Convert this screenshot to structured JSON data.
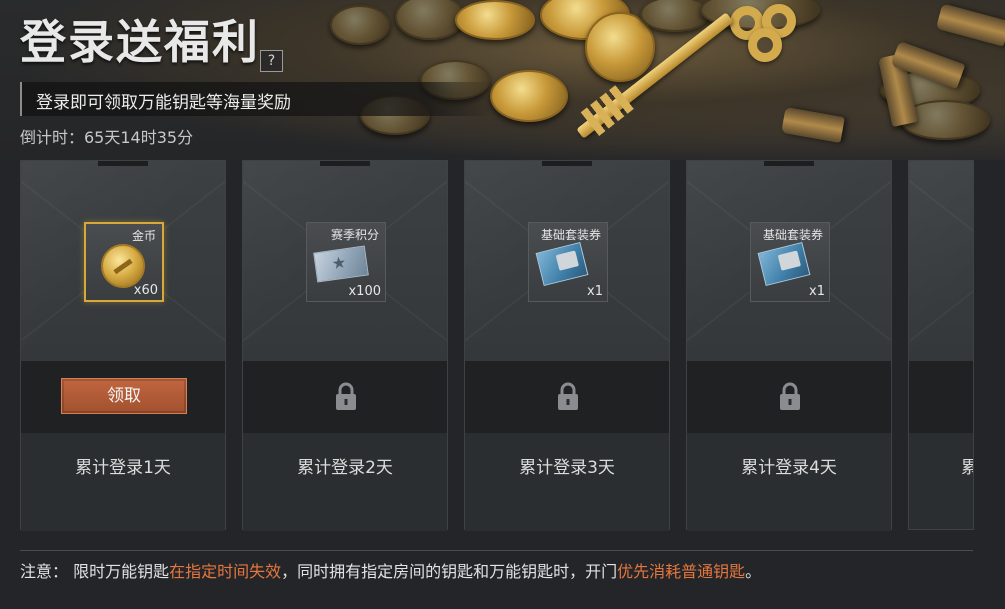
{
  "header": {
    "title": "登录送福利",
    "help_label": "?",
    "subtitle": "登录即可领取万能钥匙等海量奖励",
    "countdown": "倒计时：65天14时35分"
  },
  "cards": [
    {
      "item_name": "金币",
      "item_icon": "gold-coin-icon",
      "quantity": "x60",
      "state": "claimable",
      "button_label": "领取",
      "day_label": "累计登录1天"
    },
    {
      "item_name": "赛季积分",
      "item_icon": "season-points-ticket-icon",
      "quantity": "x100",
      "state": "locked",
      "day_label": "累计登录2天"
    },
    {
      "item_name": "基础套装券",
      "item_icon": "basic-outfit-coupon-icon",
      "quantity": "x1",
      "state": "locked",
      "day_label": "累计登录3天"
    },
    {
      "item_name": "基础套装券",
      "item_icon": "basic-outfit-coupon-icon",
      "quantity": "x1",
      "state": "locked",
      "day_label": "累计登录4天"
    },
    {
      "day_label_partial": "累"
    }
  ],
  "notice": {
    "prefix": "注意：  限时万能钥匙",
    "highlight1": "在指定时间失效",
    "middle": "，同时拥有指定房间的钥匙和万能钥匙时，开门",
    "highlight2": "优先消耗普通钥匙",
    "suffix": "。"
  },
  "colors": {
    "accent_orange": "#e5763f",
    "claim_button": "#b35a36",
    "gold_border": "#d8a83a"
  }
}
